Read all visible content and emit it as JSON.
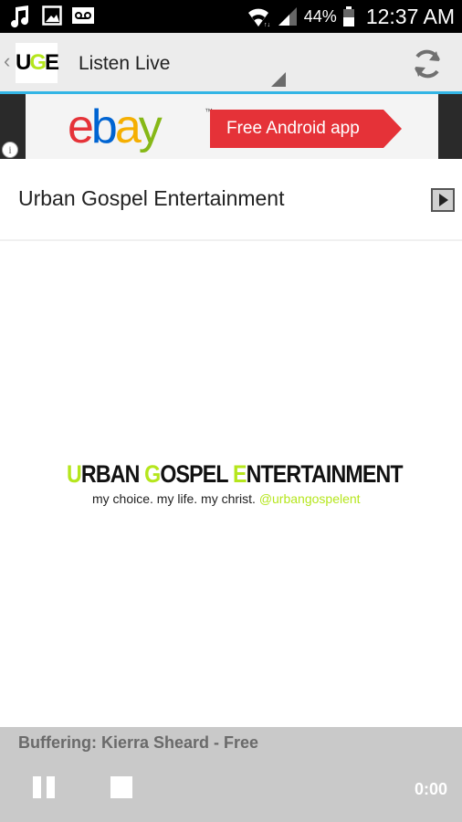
{
  "status_bar": {
    "battery_pct": "44%",
    "time": "12:37 AM",
    "icons": [
      "music-note-icon",
      "image-icon",
      "voicemail-icon",
      "wifi-icon",
      "signal-icon",
      "battery-icon"
    ]
  },
  "action_bar": {
    "logo_text": {
      "u": "U",
      "g": "G",
      "e": "E"
    },
    "title": "Listen Live",
    "icons": [
      "back-caret-icon",
      "spinner-indicator-icon",
      "refresh-icon"
    ]
  },
  "ad": {
    "brand": {
      "e": "e",
      "b": "b",
      "a": "a",
      "y": "y"
    },
    "trademark": "™",
    "cta": "Free Android app",
    "info_glyph": "i",
    "colors": {
      "red": "#e53238",
      "blue": "#0064d2",
      "yellow": "#f5af02",
      "green": "#86b817"
    }
  },
  "station": {
    "name": "Urban Gospel Entertainment",
    "icon": "play-icon"
  },
  "brand_logo": {
    "letter1": "U",
    "word1_rest": "RBAN ",
    "letter2": "G",
    "word2_rest": "OSPEL ",
    "letter3": "E",
    "word3_rest": "NTERTAINMENT",
    "tagline": "my choice. my life. my christ.",
    "handle": "@urbangospelent",
    "accent_color": "#b5e61d"
  },
  "player": {
    "now_playing": "Buffering: Kierra Sheard - Free",
    "elapsed": "0:00",
    "icons": [
      "pause-icon",
      "stop-icon"
    ]
  },
  "colors": {
    "action_bar_underline": "#33b5e5",
    "player_bg": "#c9c9c9"
  }
}
